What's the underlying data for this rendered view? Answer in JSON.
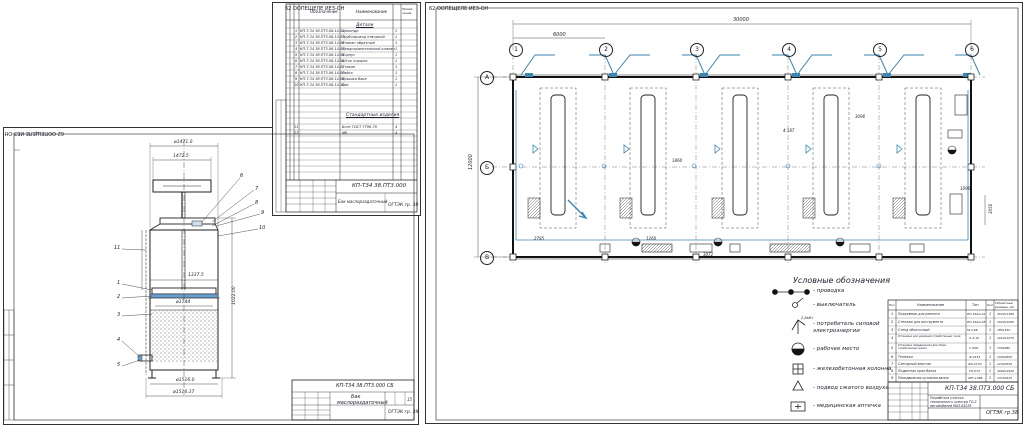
{
  "left_sheet": {
    "stamp_code": "62 ООПЕЩЕЛЕ ИЕЗ-ОН",
    "dim_top1": "ø1471.0",
    "dim_top2": "1472.5",
    "dim_mid1": "1337.5",
    "dim_mid2": "ø1744",
    "dim_bottom1": "ø1516.0",
    "dim_bottom2": "ø1516.37",
    "dim_height": "1022.00",
    "callouts": [
      "1",
      "2",
      "3",
      "4",
      "5",
      "6",
      "7",
      "8",
      "9",
      "10",
      "11"
    ],
    "title_code": "КП-Т34 38.ПТ3.000 СБ",
    "title_name1": "Бак",
    "title_name2": "маслораздаточный",
    "org": "ОГТЭК гр. 38",
    "scale": "15"
  },
  "spec_sheet": {
    "stamp_code": "62 ООПЕЩЕЛЕ ИЕЗ-ОН",
    "headers": [
      "Обозначение",
      "Наименование",
      "Приме-чание"
    ],
    "section1": "Детали",
    "rows": [
      {
        "pos": "1",
        "code": "КП-Т.34 38.ПТ3.06.14.01",
        "name": "Цилиндр",
        "qty": "1"
      },
      {
        "pos": "2",
        "code": "КП-Т.34 38.ПТ3.06.14.02",
        "name": "Трубопровод отводной",
        "qty": "1"
      },
      {
        "pos": "3",
        "code": "КП-Т.34 38.ПТ3.06.14.03",
        "name": "Клапан обратный",
        "qty": "1"
      },
      {
        "pos": "4",
        "code": "КП-Т.34 38.ПТ3.06.14.04",
        "name": "Предохранительный клапан",
        "qty": "1"
      },
      {
        "pos": "5",
        "code": "КП-Т.34 38.ПТ3.06.14.05",
        "name": "Корпус",
        "qty": "1"
      },
      {
        "pos": "6",
        "code": "КП-Т.34 38.ПТ3.06.14.06",
        "name": "Шток поршня",
        "qty": "1"
      },
      {
        "pos": "7",
        "code": "КП-Т.34 38.ПТ3.06.14.07",
        "name": "Стакан",
        "qty": "1"
      },
      {
        "pos": "8",
        "code": "КП-Т.34 38.ПТ3.06.14.08",
        "name": "Гайка",
        "qty": "1"
      },
      {
        "pos": "9",
        "code": "КП-Т.34 38.ПТ3.06.14.09",
        "name": "Крышка бака",
        "qty": "1"
      },
      {
        "pos": "10",
        "code": "КП-Т.34 38.ПТ3.06.14.10",
        "name": "Бак",
        "qty": "1"
      }
    ],
    "section2": "Стандартные изделия",
    "std_rows": [
      {
        "pos": "11",
        "code": "",
        "name": "Болт ГОСТ 7796-70",
        "qty": "4"
      },
      {
        "pos": "12",
        "code": "",
        "name": "М6",
        "qty": "4"
      }
    ],
    "title_code": "КП-Т34 38.ПТ3.000",
    "title_name": "Бак маслораздаточный",
    "org": "ОГТЭК гр. 38"
  },
  "right_sheet": {
    "stamp_code": "62 ООПЕЩЕЛЕ ИЕЗ-ОН",
    "col_labels": [
      "1",
      "2",
      "3",
      "4",
      "5",
      "6"
    ],
    "row_labels": [
      "А",
      "Б",
      "В"
    ],
    "dim_total": "30000",
    "dim_span1": "6000",
    "dim_left": "12000",
    "dims": [
      "4200",
      "4.187",
      "1860",
      "3096",
      "2785",
      "1260",
      "3072",
      "3820",
      "6071",
      "1764",
      "1300",
      "2500",
      "1096",
      "3050",
      "2000"
    ],
    "legend_title": "Условные обозначения",
    "legend": [
      {
        "symbol": "wiring",
        "text": "- проводка"
      },
      {
        "symbol": "switch",
        "text": "- выключатель"
      },
      {
        "symbol": "consumer",
        "text": "- потребитель силовой электроэнергии"
      },
      {
        "symbol": "workplace",
        "text": "- рабочее место"
      },
      {
        "symbol": "column",
        "text": "- железобетонная колонна"
      },
      {
        "symbol": "air",
        "text": "- подвод сжатого воздуха"
      },
      {
        "symbol": "firstaid",
        "text": "- медицинская аптечка"
      }
    ],
    "legend_consumer_label": "2,8кВт",
    "equip_headers": [
      "Поз",
      "Наименование",
      "Тип",
      "Кол",
      "Габаритные размеры, мм"
    ],
    "equipment": [
      {
        "pos": "1",
        "name": "Подъемник для ремонта",
        "type": "ПП-16АА-01",
        "qty": "1",
        "size": "4520х1490"
      },
      {
        "pos": "2",
        "name": "Стеллаж для инструмента",
        "type": "ПП-16АА-05",
        "qty": "1",
        "size": "1620х1000"
      },
      {
        "pos": "3",
        "name": "Стенд обкаточный",
        "type": "514-96",
        "qty": "1",
        "size": "785х340"
      },
      {
        "pos": "4",
        "name": "Установка для удаления отработанных газов",
        "type": "Л-2.10",
        "qty": "1",
        "size": "1610х1070"
      },
      {
        "pos": "5",
        "name": "Установка передвижная для сбора отработанных масел",
        "type": "С-508",
        "qty": "1",
        "size": "736х680"
      },
      {
        "pos": "6",
        "name": "Тележка",
        "type": "Ф-2153",
        "qty": "1",
        "size": "1000х600"
      },
      {
        "pos": "7",
        "name": "Слесарный верстак",
        "type": "ФО-2153",
        "qty": "1",
        "size": "1200х620"
      },
      {
        "pos": "8",
        "name": "Подвесная кран-балка",
        "type": "УП-074",
        "qty": "1",
        "size": "4000х1920"
      },
      {
        "pos": "9",
        "name": "Передвижная кузовная ванна",
        "type": "ОРГ-1598",
        "qty": "1",
        "size": "1310х625"
      }
    ],
    "title_code": "КП-Т34 38.ПТ3.000 СБ",
    "title_name": "Разработка участка технического осмотра ТО-2 автомобилей МАЗ-64229",
    "org": "ОГТЭК гр.38"
  }
}
